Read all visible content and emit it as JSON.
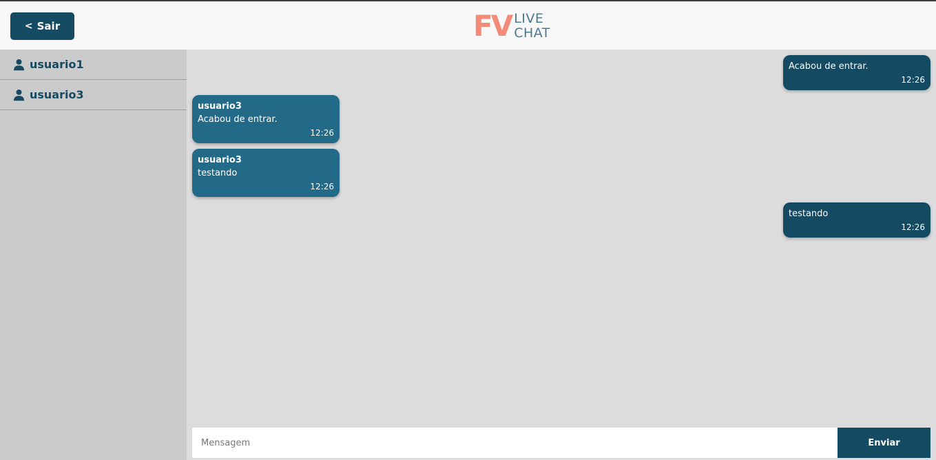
{
  "header": {
    "exit_label": "Sair",
    "exit_chevron": "<",
    "logo": {
      "mark": "FV",
      "line1": "LIVE",
      "line2": "CHAT"
    }
  },
  "colors": {
    "primary": "#154a63",
    "secondary": "#236a89",
    "accent": "#f48a78",
    "sidebar_bg": "#cbcbcb",
    "chat_bg": "#dcdcdc"
  },
  "sidebar": {
    "users": [
      {
        "name": "usuario1",
        "icon": "user-icon"
      },
      {
        "name": "usuario3",
        "icon": "user-icon"
      }
    ]
  },
  "messages": [
    {
      "own": true,
      "sender": "",
      "text": "Acabou de entrar.",
      "time": "12:26"
    },
    {
      "own": false,
      "sender": "usuario3",
      "text": "Acabou de entrar.",
      "time": "12:26"
    },
    {
      "own": false,
      "sender": "usuario3",
      "text": "testando",
      "time": "12:26"
    },
    {
      "own": true,
      "sender": "",
      "text": "testando",
      "time": "12:26"
    }
  ],
  "composer": {
    "placeholder": "Mensagem",
    "value": "",
    "send_label": "Enviar"
  }
}
